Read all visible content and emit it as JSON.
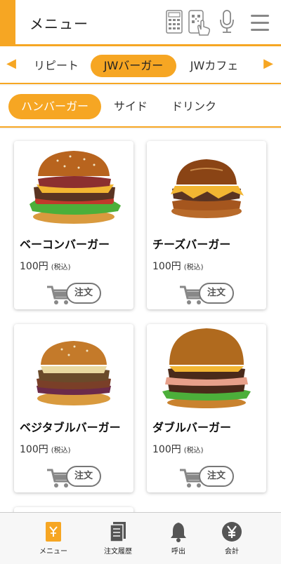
{
  "header": {
    "title": "メニュー",
    "icons": [
      "calculator-icon",
      "qr-scan-icon",
      "microphone-icon",
      "hamburger-menu-icon"
    ],
    "accent_color": "#f6a623"
  },
  "categories": {
    "items": [
      "リピート",
      "JWバーガー",
      "JWカフェ"
    ],
    "selected": "JWバーガー"
  },
  "subcategories": {
    "items": [
      "ハンバーガー",
      "サイド",
      "ドリンク"
    ],
    "selected": "ハンバーガー"
  },
  "products": [
    {
      "name": "ベーコンバーガー",
      "price": "100円",
      "tax": "(税込)",
      "order_label": "注文"
    },
    {
      "name": "チーズバーガー",
      "price": "100円",
      "tax": "(税込)",
      "order_label": "注文"
    },
    {
      "name": "ベジタブルバーガー",
      "price": "100円",
      "tax": "(税込)",
      "order_label": "注文"
    },
    {
      "name": "ダブルバーガー",
      "price": "100円",
      "tax": "(税込)",
      "order_label": "注文"
    }
  ],
  "bottom_nav": {
    "items": [
      {
        "label": "メニュー",
        "icon": "menu-book-icon",
        "active": true
      },
      {
        "label": "注文履歴",
        "icon": "order-history-icon",
        "active": false
      },
      {
        "label": "呼出",
        "icon": "bell-icon",
        "active": false
      },
      {
        "label": "会計",
        "icon": "yen-coin-icon",
        "active": false
      }
    ]
  }
}
